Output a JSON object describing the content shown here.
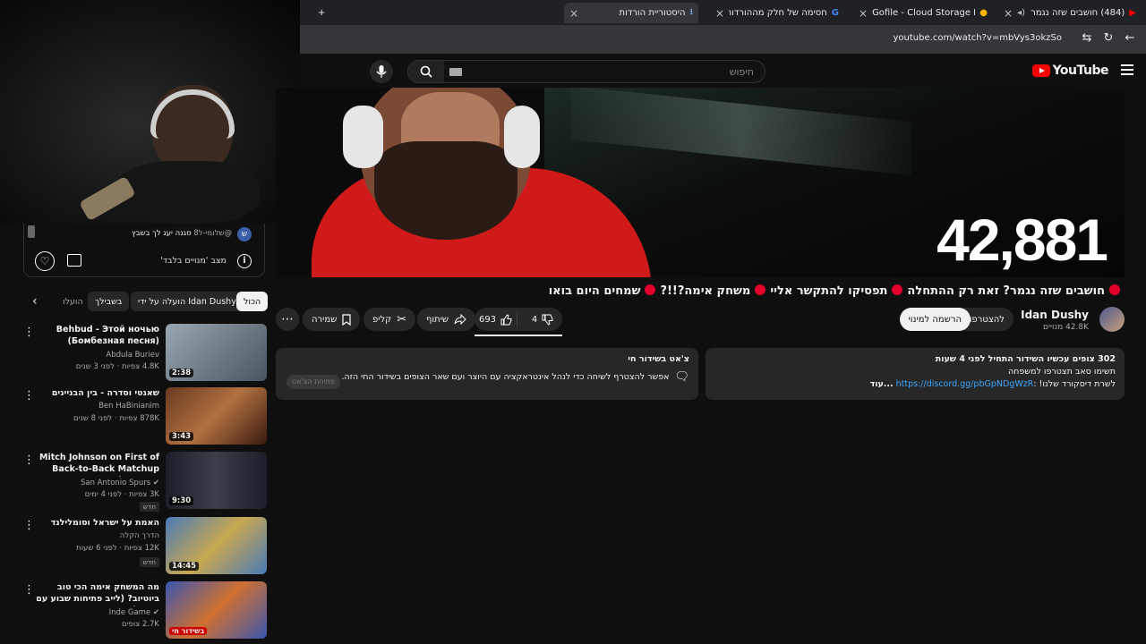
{
  "browser": {
    "tabs": [
      {
        "label": "(484) חושבים שזה נגמר",
        "icon": "youtube-icon"
      },
      {
        "label": "Gofile - Cloud Storage Made S",
        "icon": "gofile-icon"
      },
      {
        "label": "חסימה של חלק מההורדות על",
        "icon": "google-icon"
      },
      {
        "label": "היסטוריית הורדות",
        "icon": "download-icon"
      }
    ],
    "url": "youtube.com/watch?v=mbVys3okzSo"
  },
  "header": {
    "logo": "YouTube",
    "search_placeholder": "חיפוש"
  },
  "video": {
    "viewer_overlay": "42,881",
    "title_parts": [
      "חושבים שזה נגמר? זאת רק ההתחלה",
      "תפסיקו להתקשר אליי",
      "משחק אימה?!!?",
      "שמחים היום בואו"
    ]
  },
  "channel": {
    "name": "Idan Dushy",
    "subs": "42.8K מנויים",
    "join": "להצטרפות",
    "subscribe": "הרשמה למינוי"
  },
  "actions": {
    "likes": "693",
    "dislikes": "4",
    "share": "שיתוף",
    "clip": "קליפ",
    "save": "שמירה"
  },
  "description": {
    "line1_bold": "302 צופים עכשיו  השידור התחיל לפני 4 שעות",
    "line2": "תשימו סאב תצטרפו למשפחה",
    "line3_prefix": "לשרת דיסקורד שלנו! :",
    "link": "https://discord.gg/pbGpNDgWzR",
    "more": "...עוד"
  },
  "live_chat": {
    "title": "צ'אט בשידור חי",
    "body": "אפשר להצטרף לשיחה כדי לנהל אינטראקציה עם היוצר ועם שאר הצופים בשידור החי הזה.",
    "open_button": "פתיחת הצ'אט"
  },
  "sidebar_card": {
    "channel_handle": "@שלומי-ל8",
    "message": "סגנה יעג לך בשבץ",
    "mode": "מצב 'מנויים בלבד'"
  },
  "chips": [
    "הכול",
    "הועלה על ידי Idan Dushy",
    "בשבילך",
    "הועלו"
  ],
  "recommendations": [
    {
      "title": "Behbud - Этой ночью (Бомбезная песня)",
      "channel": "Abdula Buriev",
      "meta": "4.8K צפיות · לפני 3 שנים",
      "duration": "2:38",
      "verified": false,
      "new": false,
      "live": false,
      "thumb": "#7c8a95"
    },
    {
      "title": "שאנטי וסדרה - בין הבניינים",
      "channel": "Ben HaBinianim",
      "meta": "878K צפיות · לפני 8 שנים",
      "duration": "3:43",
      "verified": false,
      "new": false,
      "live": false,
      "thumb": "#8a4a2a"
    },
    {
      "title": "Mitch Johnson on First of Back-to-Back Matchup Against OKC",
      "channel": "San Antonio Spurs",
      "meta": "3K צפיות · לפני 4 ימים",
      "duration": "9:30",
      "verified": true,
      "new": true,
      "live": false,
      "thumb": "#2a2f3a"
    },
    {
      "title": "האמת על ישראל וסומלילנד",
      "channel": "הדרך הקלה",
      "meta": "12K צפיות · לפני 6 שעות",
      "duration": "14:45",
      "verified": false,
      "new": true,
      "live": false,
      "thumb": "#4a7ab8"
    },
    {
      "title": "מה המשחק אימה הכי טוב ביוטיוב? (לייב פתיחות שבוע עם אינדה)",
      "channel": "Inde Game",
      "meta": "2.7K צופים",
      "duration": "בשידור חי",
      "verified": true,
      "new": false,
      "live": true,
      "thumb": "#3a55b0"
    }
  ],
  "colors": {
    "accent_red": "#ff0000",
    "live_dot": "#e4002b",
    "link": "#3ea6ff"
  }
}
